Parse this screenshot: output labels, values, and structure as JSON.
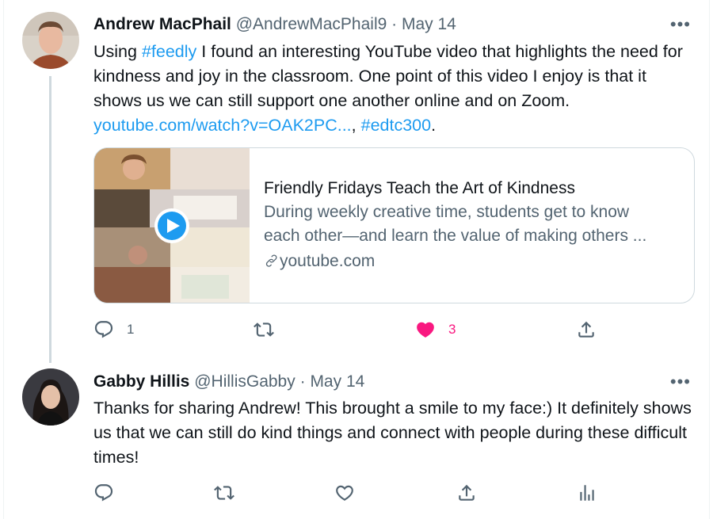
{
  "tweets": [
    {
      "name": "Andrew MacPhail",
      "handle": "@AndrewMacPhail9",
      "separator": "·",
      "date": "May 14",
      "more": "•••",
      "text_before": "Using ",
      "hashtag_feedly": "#feedly",
      "text_after": " I found an interesting YouTube video that highlights the need for kindness and joy in the classroom. One point of this video I enjoy is that it shows us we can still support one another online and on Zoom.",
      "link_youtube": "youtube.com/watch?v=OAK2PC...",
      "comma": ", ",
      "hashtag_edtc": "#edtc300",
      "period": ".",
      "card": {
        "title": "Friendly Fridays Teach the Art of Kindness",
        "description_line1": "During weekly creative time, students get to know",
        "description_line2": "each other—and learn the value of making others ...",
        "domain": "youtube.com"
      },
      "actions": {
        "reply_count": "1",
        "retweet_count": "",
        "like_count": "3",
        "liked": true
      }
    },
    {
      "name": "Gabby Hillis",
      "handle": "@HillisGabby",
      "separator": "·",
      "date": "May 14",
      "more": "•••",
      "text": "Thanks for sharing Andrew! This brought a smile to my face:) It definitely shows us that we can still do kind things and connect with people during these difficult times!"
    }
  ],
  "colors": {
    "link": "#1d9bf0",
    "secondary": "#536471",
    "like": "#f91880",
    "border": "#cfd9de"
  },
  "icons": [
    "reply-icon",
    "retweet-icon",
    "like-icon",
    "share-icon",
    "analytics-icon",
    "link-icon",
    "play-icon",
    "more-icon"
  ]
}
